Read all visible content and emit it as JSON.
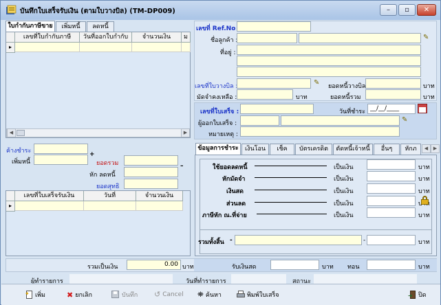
{
  "window": {
    "title": "บันทึกใบเสร็จรับเงิน (ตามใบวางบิล) (TM-DP009)",
    "controls": {
      "minimize": "–",
      "maximize": "▫",
      "close": "✕"
    }
  },
  "left_tabs": [
    "ใบกำกับภาษีขาย",
    "เพิ่มหนี้",
    "ลดหนี้"
  ],
  "invoice_grid": {
    "columns": [
      "เลขที่ใบกำกับภาษี",
      "วันที่ออกใบกำกับ",
      "จำนวนเงิน",
      "ม"
    ]
  },
  "left_mid": {
    "overpay_label": "ค้างชำระ",
    "add_debt_label": "เพิ่มหนี้",
    "plus": "+",
    "total_label": "ยอดรวม",
    "minus": "–",
    "reduce_debt_label": "หัก ลดหนี้",
    "net_label": "ยอดสุทธิ"
  },
  "receipt_grid": {
    "columns": [
      "เลขที่ใบเสร็จรับเงิน",
      "วันที่",
      "จำนวนเงิน"
    ]
  },
  "header_form": {
    "ref_label": "เลขที่ Ref.No :",
    "customer_label": "ชื่อลูกค้า :",
    "address_label": "ที่อยู่ :",
    "billing_no_label": "เลขที่ใบวางบิล :",
    "billing_amount_label": "ยอดหนี้วางบิล :",
    "deposit_label": "มัดจำคงเหลือ :",
    "baht": "บาท",
    "total_debt_label": "ยอดหนี้รวม"
  },
  "receipt_form": {
    "receipt_no_label": "เลขที่ใบเสร็จ :",
    "pay_date_label": "วันที่ชำระ :",
    "pay_date_value": "__/__/____",
    "issuer_label": "ผู้ออกใบเสร็จ :",
    "remark_label": "หมายเหตุ :"
  },
  "payment_tabs": [
    "ข้อมูลการชำระ",
    "เงินโอน",
    "เช็ค",
    "บัตรเครดิต",
    "ตัดหนี้เจ้าหนี้",
    "อื่นๆ",
    "หักภ"
  ],
  "payment_rows": [
    {
      "label": "ใช้ยอดลดหนี้",
      "unit": "เป็นเงิน",
      "baht": "บาท",
      "color": "#000000"
    },
    {
      "label": "หักมัดจำ",
      "unit": "เป็นเงิน",
      "baht": "บาท",
      "color": "#000000"
    },
    {
      "label": "เงินสด",
      "unit": "เป็นเงิน",
      "baht": "บาท",
      "color": "#000000"
    },
    {
      "label": "ส่วนลด",
      "unit": "เป็นเงิน",
      "baht": "บาท",
      "color": "#000000"
    },
    {
      "label": "ภาษีหัก ณ.ที่จ่าย",
      "unit": "เป็นเงิน",
      "baht": "บาท",
      "color": "#000000"
    }
  ],
  "payment_total": {
    "label": "รวมทั้งสิ้น",
    "dash": "-",
    "baht": "บาท"
  },
  "summary": {
    "total_money_label": "รวมเป็นเงิน",
    "total_money_value": "0.00",
    "baht": "บาท",
    "cash_received_label": "รับเงินสด",
    "baht2": "บาท",
    "change_label": "ทอน",
    "baht3": "บาท"
  },
  "status_row": {
    "recorder_label": "ผู้ทำรายการ",
    "record_date_label": "วันที่ทำรายการ",
    "status_label": "สถานะ"
  },
  "toolbar": {
    "add": "เพิ่ม",
    "cancel_edit": "ยกเลิก",
    "save": "บันทึก",
    "cancel": "Cancel",
    "search": "ค้นหา",
    "print": "พิมพ์ใบเสร็จ",
    "exit": "ปิด"
  }
}
